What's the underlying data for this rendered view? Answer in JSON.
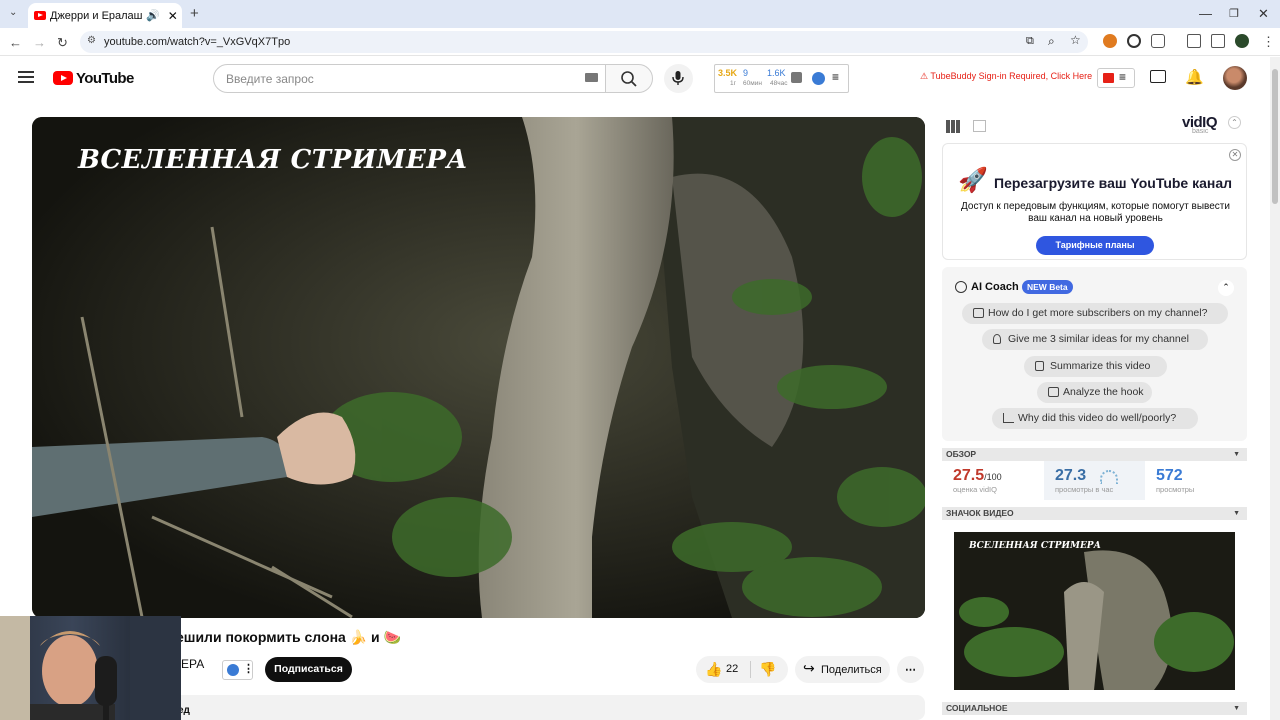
{
  "browser": {
    "tab_title": "Джерри и Ералаш решили покормить слона",
    "url": "youtube.com/watch?v=_VxGVqX7Tpo"
  },
  "yt": {
    "logo_text": "YouTube",
    "search_placeholder": "Введите запрос",
    "stat1_value": "3.5K",
    "stat1_label": "1г",
    "stat2_value": "9",
    "stat2_label": "60мин",
    "stat3_value": "1.6K",
    "stat3_label": "48час",
    "tubebuddy_text": "TubeBuddy Sign-in Required, Click Here"
  },
  "video": {
    "overlay_title": "ВСЕЛЕННАЯ СТРИМЕРА",
    "name": "ешили покормить слона 🍌 и 🍉",
    "channel_fragment": "ЕРА",
    "subscribe_label": "Подписаться",
    "likes": "22",
    "share_label": "Поделиться",
    "more_label": "⋯",
    "desc_fragment": "ед"
  },
  "vidiq": {
    "logo": "vidIQ",
    "logo_sub": "basic",
    "promo_title": "Перезагрузите ваш YouTube канал",
    "promo_body": "Доступ к передовым функциям, которые помогут вывести ваш канал на новый уровень",
    "promo_button": "Тарифные планы",
    "coach_title": "AI Coach",
    "coach_badge": "NEW Beta",
    "coach_questions": [
      "How do I get more subscribers on my channel?",
      "Give me 3 similar ideas for my channel",
      "Summarize this video",
      "Analyze the hook",
      "Why did this video do well/poorly?"
    ],
    "section_overview": "ОБЗОР",
    "score_value": "27.5",
    "score_suffix": "/100",
    "score_label": "оценка vidIQ",
    "vph_value": "27.3",
    "vph_label": "просмотры в час",
    "views_value": "572",
    "views_label": "просмотры",
    "section_thumbnail": "ЗНАЧОК ВИДЕО",
    "thumb_title": "ВСЕЛЕННАЯ СТРИМЕРА",
    "section_social": "СОЦИАЛЬНОЕ"
  },
  "colors": {
    "youtube_red": "#ff0000",
    "vidiq_blue": "#2f56e0",
    "score_red": "#c0392b",
    "stat_blue": "#3a7bd5"
  }
}
